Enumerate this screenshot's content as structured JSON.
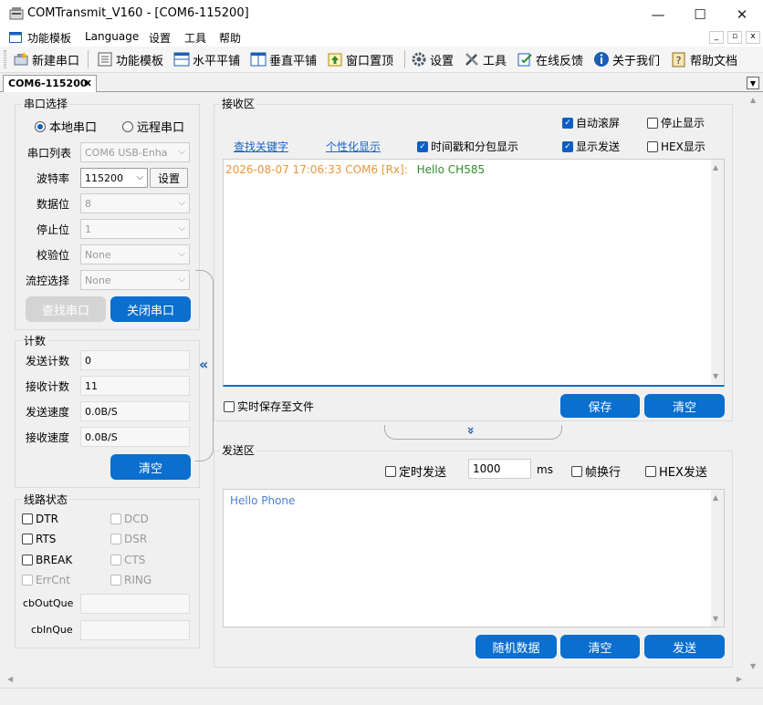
{
  "window": {
    "title": "COMTransmit_V160 - [COM6-115200]",
    "minimize": "—",
    "maximize": "☐",
    "close": "✕"
  },
  "menu": [
    "功能模板",
    "Language",
    "设置",
    "工具",
    "帮助"
  ],
  "toolbar": [
    "新建串口",
    "功能模板",
    "水平平铺",
    "垂直平铺",
    "窗口置顶",
    "设置",
    "工具",
    "在线反馈",
    "关于我们",
    "帮助文档"
  ],
  "tab": {
    "label": "COM6-115200",
    "close": "x"
  },
  "port": {
    "group_title": "串口选择",
    "local_label": "本地串口",
    "remote_label": "远程串口",
    "selected": "local",
    "port_list_label": "串口列表",
    "port_list_value": "COM6  USB-Enha",
    "baud_label": "波特率",
    "baud_value": "115200",
    "baud_settings": "设置",
    "databits_label": "数据位",
    "databits_value": "8",
    "stopbits_label": "停止位",
    "stopbits_value": "1",
    "parity_label": "校验位",
    "parity_value": "None",
    "flow_label": "流控选择",
    "flow_value": "None",
    "find_button": "查找串口",
    "close_button": "关闭串口"
  },
  "counts": {
    "group_title": "计数",
    "send_count_label": "发送计数",
    "send_count": "0",
    "recv_count_label": "接收计数",
    "recv_count": "11",
    "send_speed_label": "发送速度",
    "send_speed": "0.0B/S",
    "recv_speed_label": "接收速度",
    "recv_speed": "0.0B/S",
    "clear_button": "清空"
  },
  "line": {
    "group_title": "线路状态",
    "signals": [
      {
        "label": "DTR",
        "enabled": true
      },
      {
        "label": "DCD",
        "enabled": false
      },
      {
        "label": "RTS",
        "enabled": true
      },
      {
        "label": "DSR",
        "enabled": false
      },
      {
        "label": "BREAK",
        "enabled": true
      },
      {
        "label": "CTS",
        "enabled": false
      },
      {
        "label": "ErrCnt",
        "enabled": false
      },
      {
        "label": "RING",
        "enabled": false
      }
    ],
    "cbOutQue_label": "cbOutQue",
    "cbInQue_label": "cbInQue"
  },
  "collapse_left_icon": "«",
  "collapse_down_icon": "»",
  "receive": {
    "group_title": "接收区",
    "auto_scroll": {
      "label": "自动滚屏",
      "checked": true
    },
    "stop_display": {
      "label": "停止显示",
      "checked": false
    },
    "find_keyword": "查找关键字",
    "personalize": "个性化显示",
    "timestamp": {
      "label": "时间戳和分包显示",
      "checked": true
    },
    "show_send": {
      "label": "显示发送",
      "checked": true
    },
    "hex_display": {
      "label": "HEX显示",
      "checked": false
    },
    "log": {
      "timestamp": "2026-08-07 17:06:33 COM6 [Rx]:",
      "text": "Hello CH585"
    },
    "save_to_file": {
      "label": "实时保存至文件",
      "checked": false
    },
    "save_button": "保存",
    "clear_button": "清空"
  },
  "send": {
    "group_title": "发送区",
    "timed_send": {
      "label": "定时发送",
      "checked": false
    },
    "interval": "1000",
    "unit": "ms",
    "frame_newline": {
      "label": "帧换行",
      "checked": false
    },
    "hex_send": {
      "label": "HEX发送",
      "checked": false
    },
    "text": "Hello Phone",
    "random_button": "随机数据",
    "clear_button": "清空",
    "send_button": "发送"
  },
  "colors": {
    "accent": "#0a6fcf",
    "timestamp": "#e8963a",
    "rx_text": "#2e8b2e",
    "send_text": "#4a7fd4"
  }
}
